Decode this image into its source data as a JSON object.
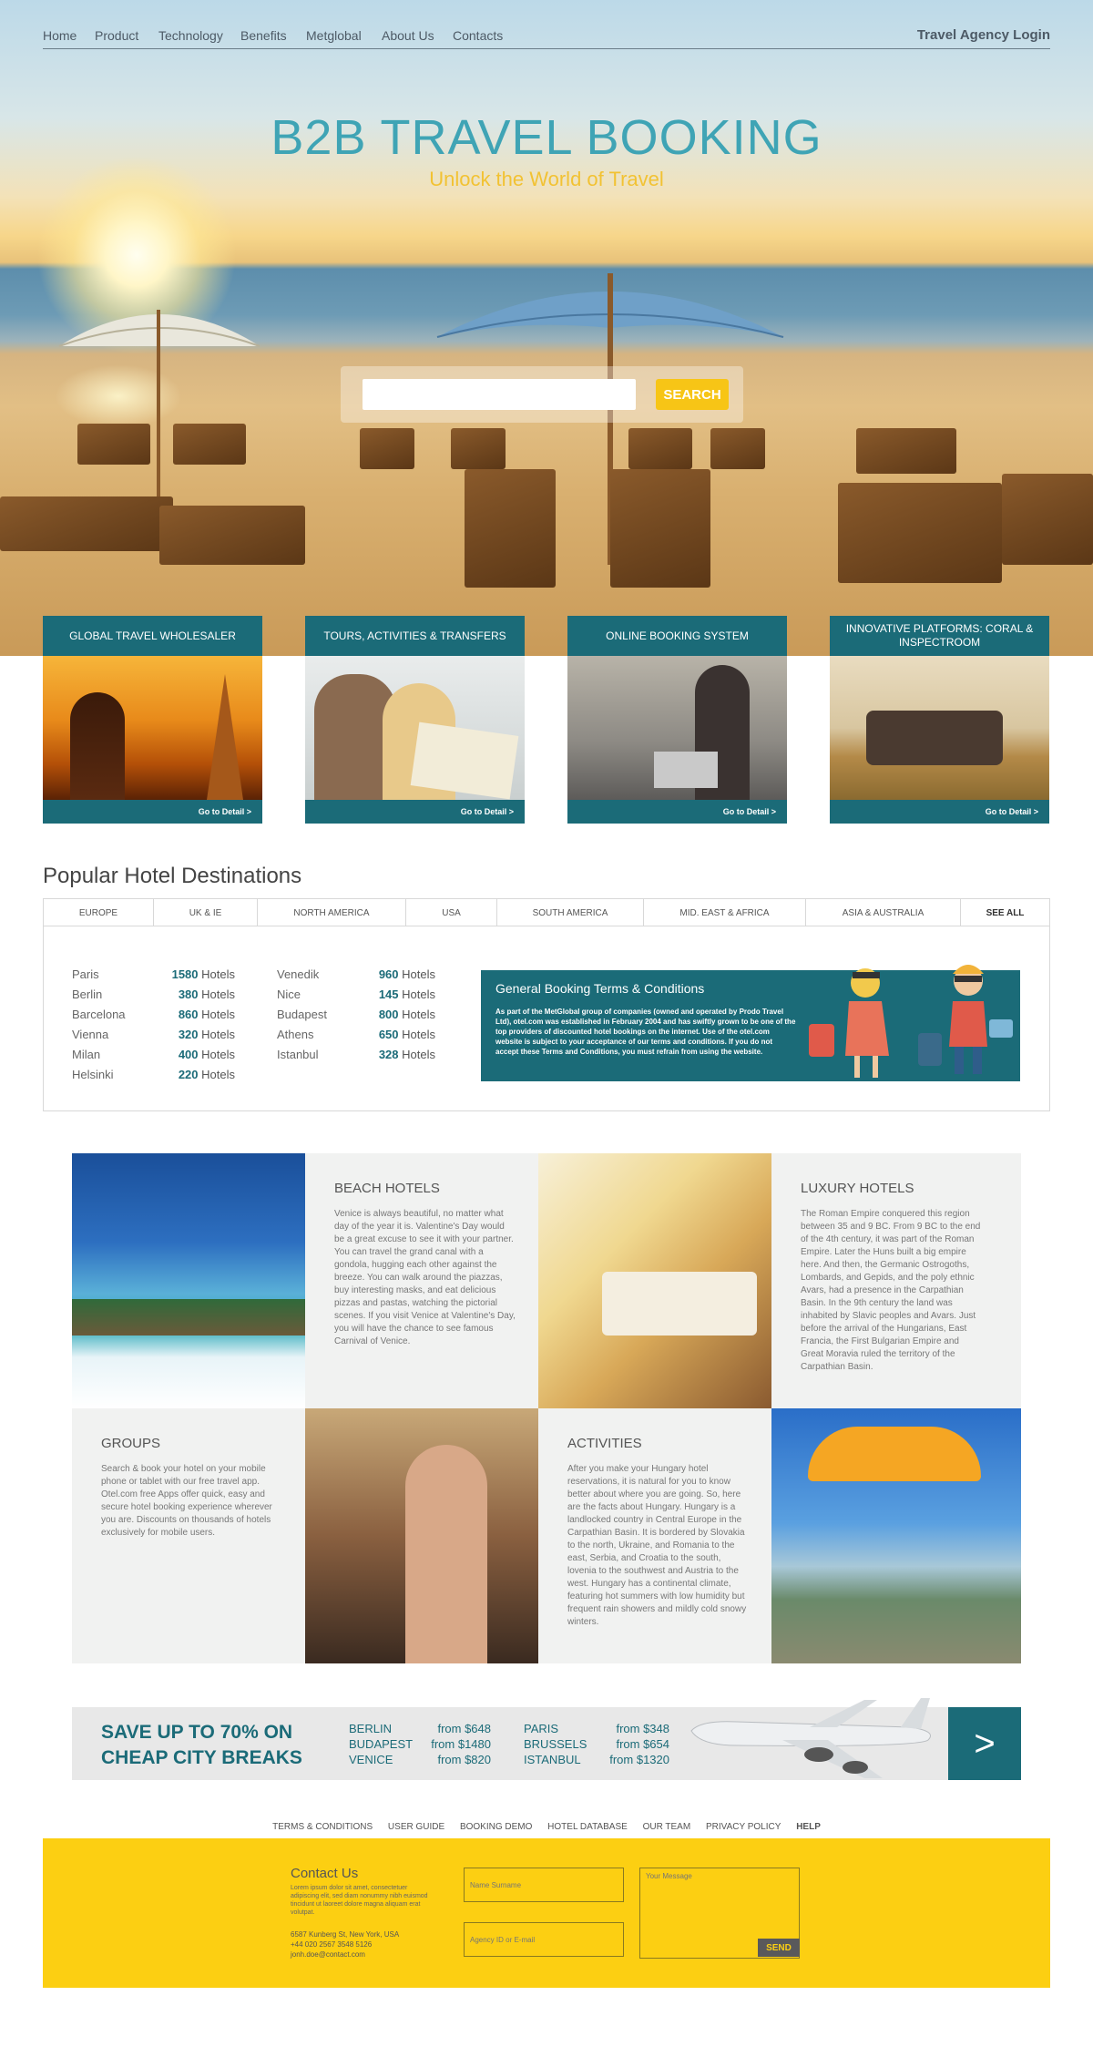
{
  "nav": {
    "items": [
      "Home",
      "Product",
      "Technology",
      "Benefits",
      "Metglobal",
      "About Us",
      "Contacts"
    ],
    "login": "Travel Agency Login"
  },
  "hero": {
    "title": "B2B TRAVEL BOOKING",
    "subtitle": "Unlock the World of Travel",
    "search_placeholder": "",
    "search_button": "SEARCH"
  },
  "services": [
    {
      "title": "GLOBAL TRAVEL WHOLESALER",
      "link": "Go to Detail >"
    },
    {
      "title": "TOURS, ACTIVITIES & TRANSFERS",
      "link": "Go to Detail >"
    },
    {
      "title": "ONLINE BOOKING SYSTEM",
      "link": "Go to Detail >"
    },
    {
      "title": "INNOVATIVE PLATFORMS: CORAL & INSPECTROOM",
      "link": "Go to Detail >"
    }
  ],
  "popular": {
    "title": "Popular Hotel Destinations",
    "tabs": [
      "EUROPE",
      "UK & IE",
      "NORTH AMERICA",
      "USA",
      "SOUTH AMERICA",
      "MID. EAST & AFRICA",
      "ASIA & AUSTRALIA",
      "SEE ALL"
    ],
    "hotels_word": "Hotels",
    "col1": [
      {
        "city": "Paris",
        "count": "1580"
      },
      {
        "city": "Berlin",
        "count": "380"
      },
      {
        "city": "Barcelona",
        "count": "860"
      },
      {
        "city": "Vienna",
        "count": "320"
      },
      {
        "city": "Milan",
        "count": "400"
      },
      {
        "city": "Helsinki",
        "count": "220"
      }
    ],
    "col2": [
      {
        "city": "Venedik",
        "count": "960"
      },
      {
        "city": "Nice",
        "count": "145"
      },
      {
        "city": "Budapest",
        "count": "800"
      },
      {
        "city": "Athens",
        "count": "650"
      },
      {
        "city": "Istanbul",
        "count": "328"
      }
    ],
    "terms_title": "General Booking Terms & Conditions",
    "terms_text": "As part of the MetGlobal group of companies (owned and operated by Prodo Travel Ltd), otel.com was established in February 2004 and has swiftly grown to be one of the top providers of discounted hotel bookings on the internet. Use of the otel.com website is subject to your acceptance of our terms and conditions. If you do not accept these Terms and Conditions, you must refrain from using the website."
  },
  "grid": {
    "beach": {
      "title": "BEACH HOTELS",
      "text": "Venice is always beautiful, no matter what day of the year it is. Valentine's Day would be a great excuse to see it with your partner. You can travel the grand canal with a gondola, hugging each other against the breeze. You can walk around the piazzas, buy interesting masks, and eat delicious pizzas and pastas, watching the pictorial scenes. If you visit Venice at Valentine's Day, you will have the chance to see famous Carnival of Venice."
    },
    "luxury": {
      "title": "LUXURY HOTELS",
      "text": "The Roman Empire conquered this region between 35 and 9 BC. From 9 BC to the end of the 4th century, it was part of the Roman Empire. Later the Huns built a big empire here. And then, the Germanic Ostrogoths, Lombards, and Gepids, and the poly ethnic Avars, had a presence in the Carpathian Basin. In the 9th century the land was inhabited by Slavic peoples and Avars. Just before the arrival of the Hungarians, East Francia, the First Bulgarian Empire and Great Moravia ruled the territory of the Carpathian Basin."
    },
    "groups": {
      "title": "GROUPS",
      "text": "Search & book your hotel on your mobile phone or tablet with our free travel app. Otel.com free Apps offer quick, easy and secure hotel booking experience wherever you are. Discounts on thousands of hotels exclusively for mobile users."
    },
    "activities": {
      "title": "ACTIVITIES",
      "text": "After you make your Hungary hotel reservations, it is natural for you to know better about where you are going. So, here are the facts about Hungary. Hungary is a landlocked country in Central Europe in the Carpathian Basin. It is bordered by Slovakia to the north, Ukraine, and Romania to the east, Serbia, and Croatia to the south, lovenia to the southwest and Austria to the west. Hungary has a continental climate, featuring hot summers with low humidity but frequent rain showers and mildly cold snowy winters."
    }
  },
  "save": {
    "title": "SAVE UP TO 70% ON CHEAP CITY BREAKS",
    "deals_left": [
      {
        "city": "BERLIN",
        "price": "from $648"
      },
      {
        "city": "BUDAPEST",
        "price": "from $1480"
      },
      {
        "city": "VENICE",
        "price": "from $820"
      }
    ],
    "deals_right": [
      {
        "city": "PARIS",
        "price": "from $348"
      },
      {
        "city": "BRUSSELS",
        "price": "from $654"
      },
      {
        "city": "ISTANBUL",
        "price": "from $1320"
      }
    ],
    "arrow": ">"
  },
  "footer": {
    "links": [
      "TERMS & CONDITIONS",
      "USER GUIDE",
      "BOOKING DEMO",
      "HOTEL DATABASE",
      "OUR TEAM",
      "PRIVACY POLICY",
      "HELP"
    ],
    "contact_title": "Contact Us",
    "lorem": "Lorem ipsum dolor sit amet, consectetuer adipiscing elit, sed diam nonummy nibh euismod tincidunt ut laoreet dolore magna aliquam erat volutpat.",
    "address": "6587 Kunberg St, New York, USA",
    "phone": "+44 020 2567 3548 5126",
    "email": "jonh.doe@contact.com",
    "name_placeholder": "Name Surname",
    "agency_placeholder": "Agency ID or E-mail",
    "message_placeholder": "Your Message",
    "send": "SEND"
  },
  "colors": {
    "teal": "#1b6b78",
    "yellow": "#fccf12",
    "hero_title": "#3fa4b5",
    "subtitle": "#f2c233"
  }
}
